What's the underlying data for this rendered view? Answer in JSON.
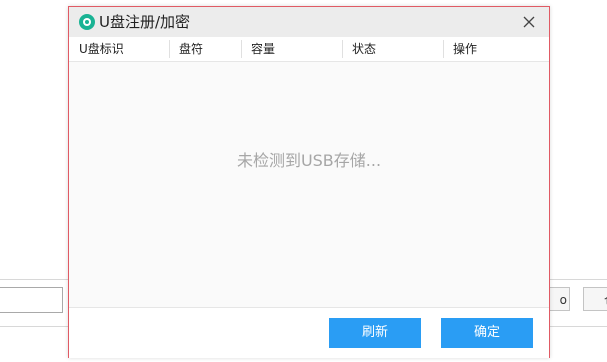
{
  "background": {
    "right_button_label": "o",
    "far_button_label": "仓"
  },
  "dialog": {
    "title": "U盘注册/加密",
    "icon": "app-logo-icon",
    "close_icon": "close-icon",
    "columns": [
      "U盘标识",
      "盘符",
      "容量",
      "状态",
      "操作"
    ],
    "empty_message": "未检测到USB存储...",
    "buttons": {
      "refresh": "刷新",
      "ok": "确定"
    }
  },
  "colors": {
    "accent": "#2a9df4",
    "icon": "#1ab394",
    "border": "#e05a64"
  }
}
